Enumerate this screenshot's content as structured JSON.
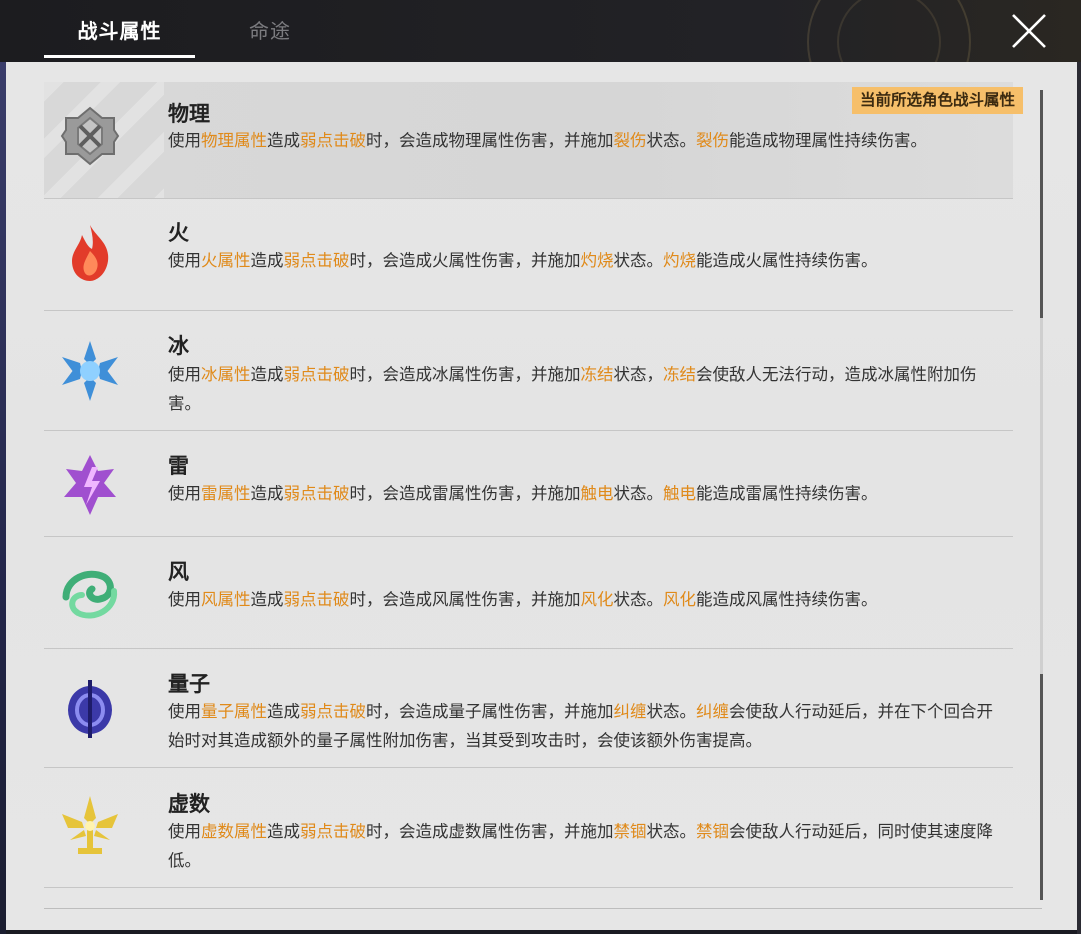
{
  "tabs": [
    {
      "label": "战斗属性",
      "active": true
    },
    {
      "label": "命途",
      "active": false
    }
  ],
  "badge": "当前所选角色战斗属性",
  "colors": {
    "highlight": "#e08a1a",
    "badge_bg": "#f6bf6a"
  },
  "elements": [
    {
      "name": "物理",
      "icon": "physical-icon",
      "desc": [
        [
          "使用",
          ""
        ],
        [
          "物理属性",
          "h"
        ],
        [
          "造成",
          ""
        ],
        [
          "弱点击破",
          "h"
        ],
        [
          "时，会造成物理属性伤害，并施加",
          ""
        ],
        [
          "裂伤",
          "h"
        ],
        [
          "状态。",
          ""
        ],
        [
          "裂伤",
          "h"
        ],
        [
          "能造成物理属性持续伤害。",
          ""
        ]
      ]
    },
    {
      "name": "火",
      "icon": "fire-icon",
      "desc": [
        [
          "使用",
          ""
        ],
        [
          "火属性",
          "h"
        ],
        [
          "造成",
          ""
        ],
        [
          "弱点击破",
          "h"
        ],
        [
          "时，会造成火属性伤害，并施加",
          ""
        ],
        [
          "灼烧",
          "h"
        ],
        [
          "状态。",
          ""
        ],
        [
          "灼烧",
          "h"
        ],
        [
          "能造成火属性持续伤害。",
          ""
        ]
      ]
    },
    {
      "name": "冰",
      "icon": "ice-icon",
      "desc": [
        [
          "使用",
          ""
        ],
        [
          "冰属性",
          "h"
        ],
        [
          "造成",
          ""
        ],
        [
          "弱点击破",
          "h"
        ],
        [
          "时，会造成冰属性伤害，并施加",
          ""
        ],
        [
          "冻结",
          "h"
        ],
        [
          "状态，",
          ""
        ],
        [
          "冻结",
          "h"
        ],
        [
          "会使敌人无法行动，造成冰属性附加伤害。",
          ""
        ]
      ]
    },
    {
      "name": "雷",
      "icon": "lightning-icon",
      "desc": [
        [
          "使用",
          ""
        ],
        [
          "雷属性",
          "h"
        ],
        [
          "造成",
          ""
        ],
        [
          "弱点击破",
          "h"
        ],
        [
          "时，会造成雷属性伤害，并施加",
          ""
        ],
        [
          "触电",
          "h"
        ],
        [
          "状态。",
          ""
        ],
        [
          "触电",
          "h"
        ],
        [
          "能造成雷属性持续伤害。",
          ""
        ]
      ]
    },
    {
      "name": "风",
      "icon": "wind-icon",
      "desc": [
        [
          "使用",
          ""
        ],
        [
          "风属性",
          "h"
        ],
        [
          "造成",
          ""
        ],
        [
          "弱点击破",
          "h"
        ],
        [
          "时，会造成风属性伤害，并施加",
          ""
        ],
        [
          "风化",
          "h"
        ],
        [
          "状态。",
          ""
        ],
        [
          "风化",
          "h"
        ],
        [
          "能造成风属性持续伤害。",
          ""
        ]
      ]
    },
    {
      "name": "量子",
      "icon": "quantum-icon",
      "desc": [
        [
          "使用",
          ""
        ],
        [
          "量子属性",
          "h"
        ],
        [
          "造成",
          ""
        ],
        [
          "弱点击破",
          "h"
        ],
        [
          "时，会造成量子属性伤害，并施加",
          ""
        ],
        [
          "纠缠",
          "h"
        ],
        [
          "状态。",
          ""
        ],
        [
          "纠缠",
          "h"
        ],
        [
          "会使敌人行动延后，并在下个回合开始时对其造成额外的量子属性附加伤害，当其受到攻击时，会使该额外伤害提高。",
          ""
        ]
      ]
    },
    {
      "name": "虚数",
      "icon": "imaginary-icon",
      "desc": [
        [
          "使用",
          ""
        ],
        [
          "虚数属性",
          "h"
        ],
        [
          "造成",
          ""
        ],
        [
          "弱点击破",
          "h"
        ],
        [
          "时，会造成虚数属性伤害，并施加",
          ""
        ],
        [
          "禁锢",
          "h"
        ],
        [
          "状态。",
          ""
        ],
        [
          "禁锢",
          "h"
        ],
        [
          "会使敌人行动延后，同时使其速度降低。",
          ""
        ]
      ]
    }
  ]
}
